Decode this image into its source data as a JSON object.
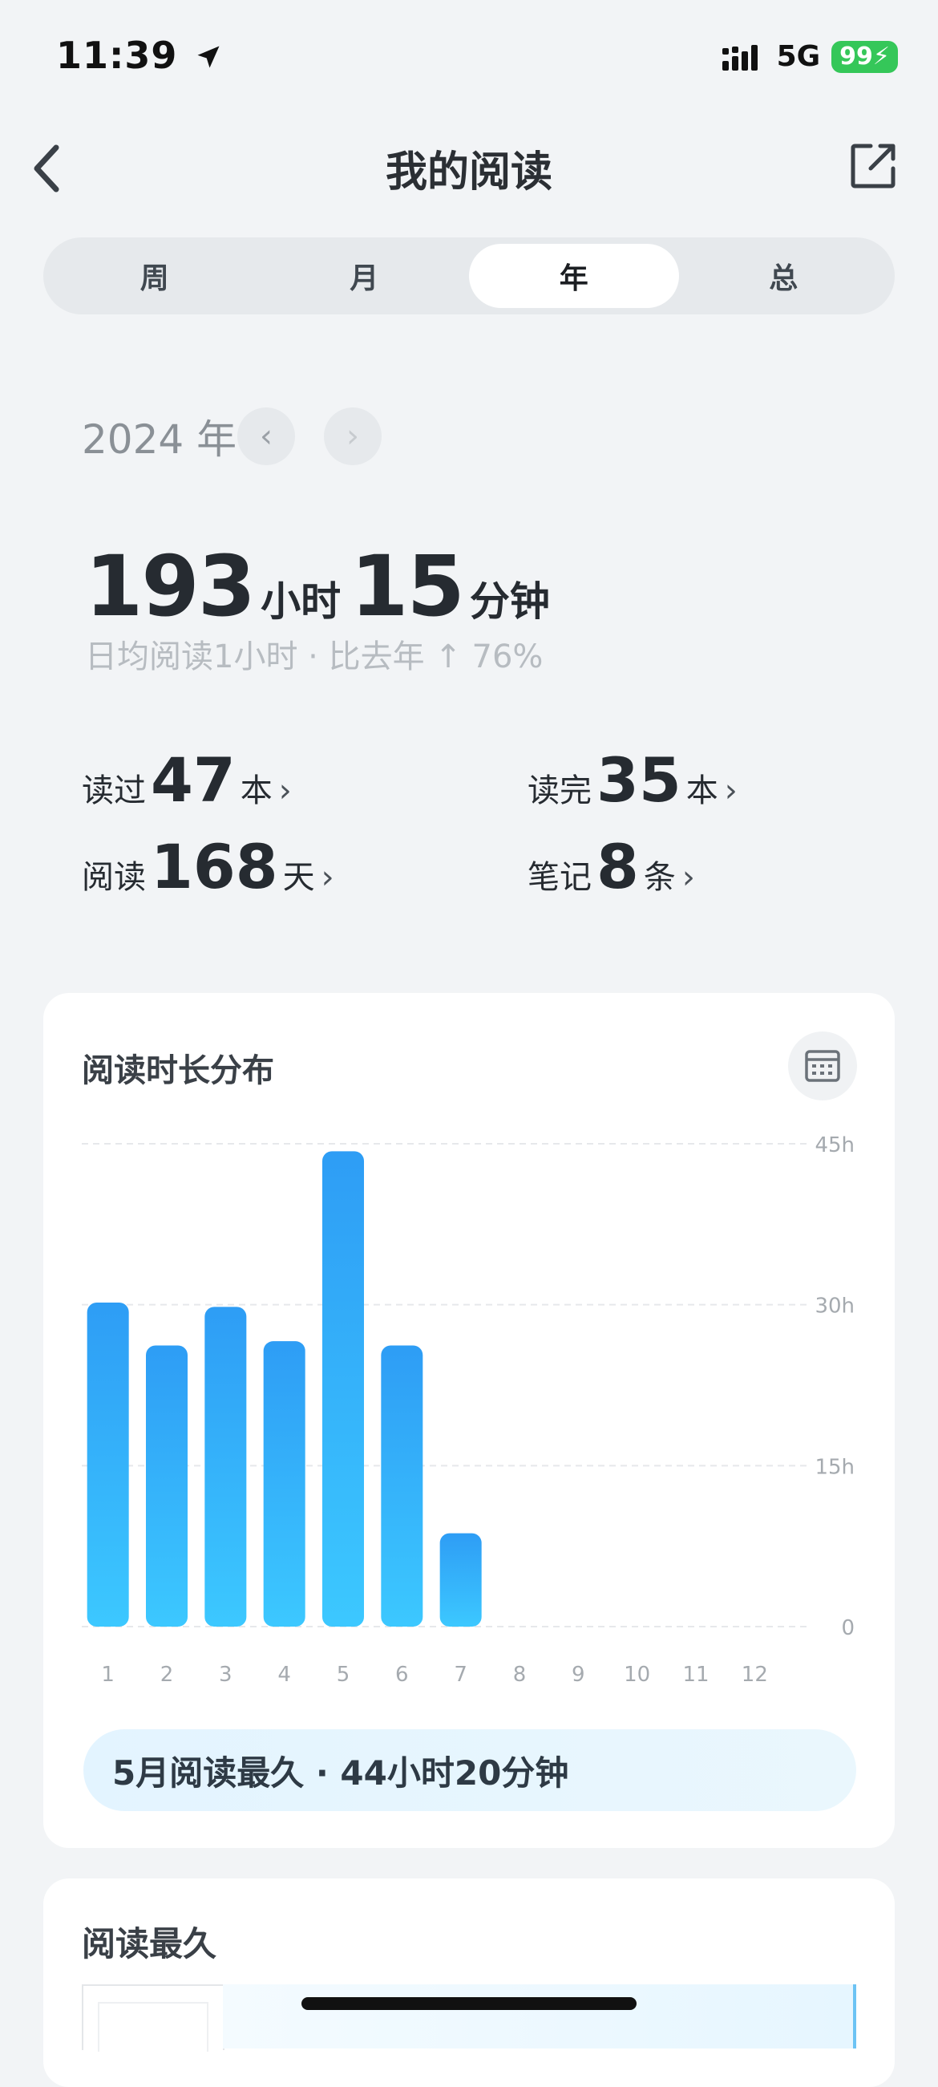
{
  "status_bar": {
    "time": "11:39",
    "network": "5G",
    "battery": "99"
  },
  "nav": {
    "title": "我的阅读"
  },
  "tabs": [
    {
      "label": "周",
      "active": false
    },
    {
      "label": "月",
      "active": false
    },
    {
      "label": "年",
      "active": true
    },
    {
      "label": "总",
      "active": false
    }
  ],
  "period": {
    "label": "2024 年"
  },
  "total": {
    "hours": "193",
    "hours_unit": "小时",
    "minutes": "15",
    "minutes_unit": "分钟",
    "subtitle": "日均阅读1小时 · 比去年 ↑ 76%"
  },
  "stats": {
    "read": {
      "label": "读过",
      "value": "47",
      "unit": "本"
    },
    "finished": {
      "label": "读完",
      "value": "35",
      "unit": "本"
    },
    "days": {
      "label": "阅读",
      "value": "168",
      "unit": "天"
    },
    "notes": {
      "label": "笔记",
      "value": "8",
      "unit": "条"
    }
  },
  "chart_card": {
    "title": "阅读时长分布",
    "summary": "5月阅读最久 · 44小时20分钟"
  },
  "chart_data": {
    "type": "bar",
    "categories": [
      "1",
      "2",
      "3",
      "4",
      "5",
      "6",
      "7",
      "8",
      "9",
      "10",
      "11",
      "12"
    ],
    "values": [
      30.2,
      26.2,
      29.8,
      26.6,
      44.3,
      26.2,
      8.7,
      0,
      0,
      0,
      0,
      0
    ],
    "yticks": [
      "45h",
      "30h",
      "15h",
      "0"
    ],
    "ytick_values": [
      45,
      30,
      15,
      0
    ],
    "ylim": [
      0,
      45
    ],
    "grid": true,
    "colors": {
      "bar_top": "#2e9df5",
      "bar_bottom": "#3cc8ff",
      "grid": "#e6e8eb",
      "tick": "#a5aaaf"
    }
  },
  "longest": {
    "title": "阅读最久"
  },
  "colors": {
    "accent": "#2f9ff6",
    "background": "#f2f4f6",
    "battery": "#35c759"
  }
}
